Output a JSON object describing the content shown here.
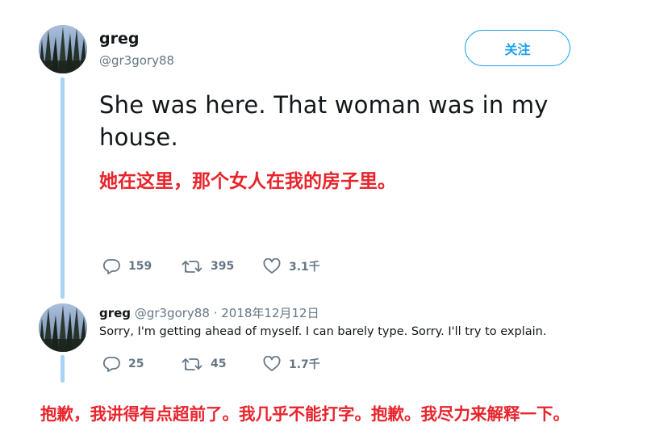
{
  "main_tweet": {
    "name": "greg",
    "handle": "@gr3gory88",
    "follow_label": "关注",
    "text": "She was here. That woman was in my house.",
    "translation": "她在这里，那个女人在我的房子里。",
    "actions": {
      "replies": "159",
      "retweets": "395",
      "likes": "3.1千"
    }
  },
  "reply_tweet": {
    "name": "greg",
    "handle": "@gr3gory88",
    "separator": "·",
    "date": "2018年12月12日",
    "text": "Sorry, I'm getting ahead of myself. I can barely type. Sorry. I'll try to explain.",
    "translation": "抱歉，我讲得有点超前了。我几乎不能打字。抱歉。我尽力来解释一下。",
    "actions": {
      "replies": "25",
      "retweets": "45",
      "likes": "1.7千"
    }
  },
  "colors": {
    "accent": "#1da1f2",
    "thread_line": "#a9d4f5",
    "translation_red": "#e8242c",
    "secondary_text": "#657786"
  },
  "icons": [
    "avatar-forest",
    "reply-icon",
    "retweet-icon",
    "like-icon"
  ]
}
